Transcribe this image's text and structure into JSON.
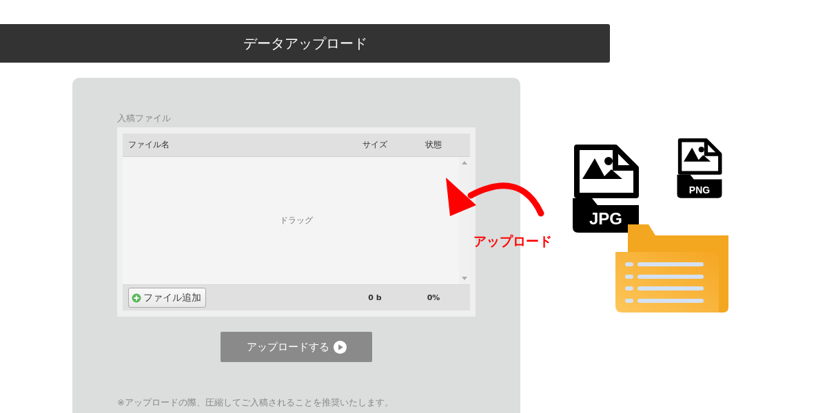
{
  "header": {
    "title": "データアップロード"
  },
  "uploader": {
    "label": "入稿ファイル",
    "columns": [
      "ファイル名",
      "サイズ",
      "状態"
    ],
    "drop_hint": "ドラッグ",
    "add_button": "ファイル追加",
    "total_size": "0 b",
    "total_progress": "0%"
  },
  "upload_button": "アップロードする",
  "note": "※アップロードの際、圧縮してご入稿されることを推奨いたします。",
  "illustration": {
    "arrow_label": "アップロード",
    "file_types": [
      "JPG",
      "PNG"
    ]
  }
}
